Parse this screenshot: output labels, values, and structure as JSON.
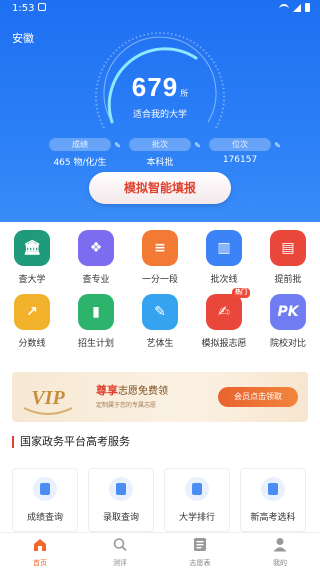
{
  "status_bar": {
    "time": "1:53"
  },
  "header": {
    "province": "安徽",
    "score": "679",
    "score_unit": "所",
    "score_caption": "适合我的大学",
    "stats": [
      {
        "label": "成绩",
        "value": "465 物/化/生"
      },
      {
        "label": "批次",
        "value": "本科批"
      },
      {
        "label": "位次",
        "value": "176157"
      }
    ],
    "cta_label": "模拟智能填报"
  },
  "features": [
    {
      "label": "查大学",
      "icon": "university-icon",
      "color": "#1f9a7a"
    },
    {
      "label": "查专业",
      "icon": "layers-icon",
      "color": "#7b6cf0"
    },
    {
      "label": "一分一段",
      "icon": "document-icon",
      "color": "#f37a35"
    },
    {
      "label": "批次线",
      "icon": "bar-chart-icon",
      "color": "#3a82f5"
    },
    {
      "label": "提前批",
      "icon": "scroll-icon",
      "color": "#e9473a"
    },
    {
      "label": "分数线",
      "icon": "trend-chart-icon",
      "color": "#f2b22b"
    },
    {
      "label": "招生计划",
      "icon": "book-icon",
      "color": "#2db36b"
    },
    {
      "label": "艺体生",
      "icon": "palette-icon",
      "color": "#35a3f0"
    },
    {
      "label": "模拟报志愿",
      "icon": "form-icon",
      "color": "#e9473a",
      "badge": "热门"
    },
    {
      "label": "院校对比",
      "icon": "pk-icon",
      "color": "#6f7cf2",
      "glyph": "PK"
    }
  ],
  "vip_banner": {
    "badge_text": "VIP",
    "title_highlight": "尊享",
    "title_rest": "志愿免费领",
    "subtitle": "定制属于您的专属志愿",
    "button_label": "会员点击领取"
  },
  "services": {
    "title": "国家政务平台高考服务",
    "items": [
      {
        "label": "成绩查询"
      },
      {
        "label": "录取查询"
      },
      {
        "label": "大学排行"
      },
      {
        "label": "新高考选科"
      }
    ]
  },
  "bottom_nav": [
    {
      "label": "首页",
      "icon": "home-icon",
      "active": true
    },
    {
      "label": "测评",
      "icon": "search-icon",
      "active": false
    },
    {
      "label": "志愿表",
      "icon": "list-icon",
      "active": false
    },
    {
      "label": "我的",
      "icon": "user-icon",
      "active": false
    }
  ],
  "colors": {
    "primary": "#2b7ff6",
    "accent": "#e1412f",
    "nav_active": "#f06a2b"
  }
}
